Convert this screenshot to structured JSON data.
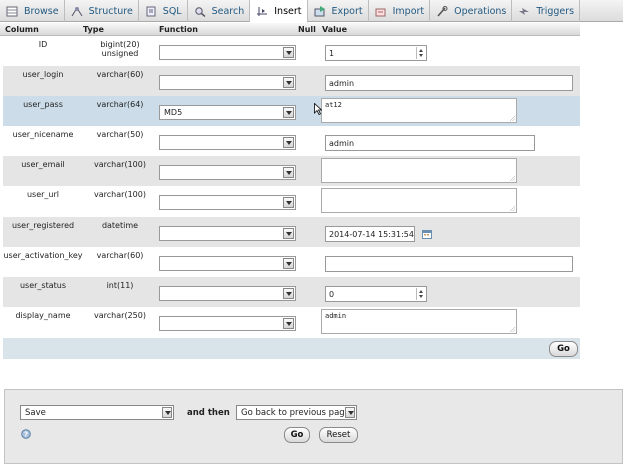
{
  "tabs": [
    {
      "label": "Browse",
      "icon": "browse-icon"
    },
    {
      "label": "Structure",
      "icon": "structure-icon"
    },
    {
      "label": "SQL",
      "icon": "sql-icon"
    },
    {
      "label": "Search",
      "icon": "search-icon"
    },
    {
      "label": "Insert",
      "icon": "insert-icon",
      "active": true
    },
    {
      "label": "Export",
      "icon": "export-icon"
    },
    {
      "label": "Import",
      "icon": "import-icon"
    },
    {
      "label": "Operations",
      "icon": "operations-icon"
    },
    {
      "label": "Triggers",
      "icon": "triggers-icon"
    }
  ],
  "headers": {
    "column": "Column",
    "type": "Type",
    "function": "Function",
    "null": "Null",
    "value": "Value"
  },
  "rows": [
    {
      "column": "ID",
      "type": "bigint(20) unsigned",
      "function": "",
      "value": "1"
    },
    {
      "column": "user_login",
      "type": "varchar(60)",
      "function": "",
      "value": "admin"
    },
    {
      "column": "user_pass",
      "type": "varchar(64)",
      "function": "MD5",
      "value": "at12"
    },
    {
      "column": "user_nicename",
      "type": "varchar(50)",
      "function": "",
      "value": "admin"
    },
    {
      "column": "user_email",
      "type": "varchar(100)",
      "function": "",
      "value": ""
    },
    {
      "column": "user_url",
      "type": "varchar(100)",
      "function": "",
      "value": ""
    },
    {
      "column": "user_registered",
      "type": "datetime",
      "function": "",
      "value": "2014-07-14 15:31:54"
    },
    {
      "column": "user_activation_key",
      "type": "varchar(60)",
      "function": "",
      "value": ""
    },
    {
      "column": "user_status",
      "type": "int(11)",
      "function": "",
      "value": "0"
    },
    {
      "column": "display_name",
      "type": "varchar(250)",
      "function": "",
      "value": "admin"
    }
  ],
  "form_go": "Go",
  "bottom": {
    "action": "Save",
    "and_then": "and then",
    "after": "Go back to previous page",
    "go": "Go",
    "reset": "Reset"
  },
  "colors": {
    "highlight_row": "#ccdde9",
    "even_row": "#e5e5e5",
    "link": "#235a81"
  }
}
